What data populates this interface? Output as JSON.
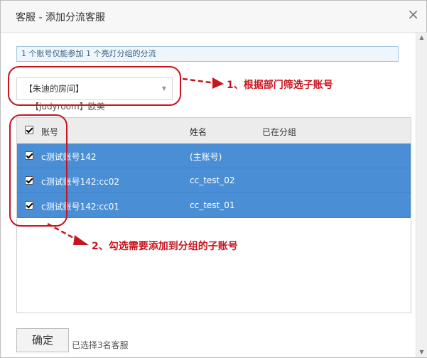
{
  "dialog": {
    "title": "客服 - 添加分流客服",
    "close_label": "×"
  },
  "notice": "1 个账号仅能参加 1 个亮灯分组的分流",
  "department": {
    "selected": "【朱迪的房间】",
    "caret": "▼",
    "sub_text": "【judyroom】欧美"
  },
  "annotations": {
    "step1": "1、根据部门筛选子账号",
    "step2": "2、勾选需要添加到分组的子账号"
  },
  "table": {
    "headers": {
      "account": "账号",
      "name": "姓名",
      "group": "已在分组"
    },
    "rows": [
      {
        "account": "c测试账号142",
        "name": "(主账号)",
        "group": ""
      },
      {
        "account": "c测试账号142:cc02",
        "name": "cc_test_02",
        "group": ""
      },
      {
        "account": "c测试账号142:cc01",
        "name": "cc_test_01",
        "group": ""
      }
    ]
  },
  "footer": {
    "ok_label": "确定",
    "selected_count": "已选择3名客服"
  },
  "colors": {
    "annotation": "#c8141e",
    "row_selected": "#4a8fd6"
  },
  "icons": {
    "close": "close-icon",
    "dropdown": "chevron-down-icon",
    "checkbox": "checkbox-checked-icon"
  }
}
